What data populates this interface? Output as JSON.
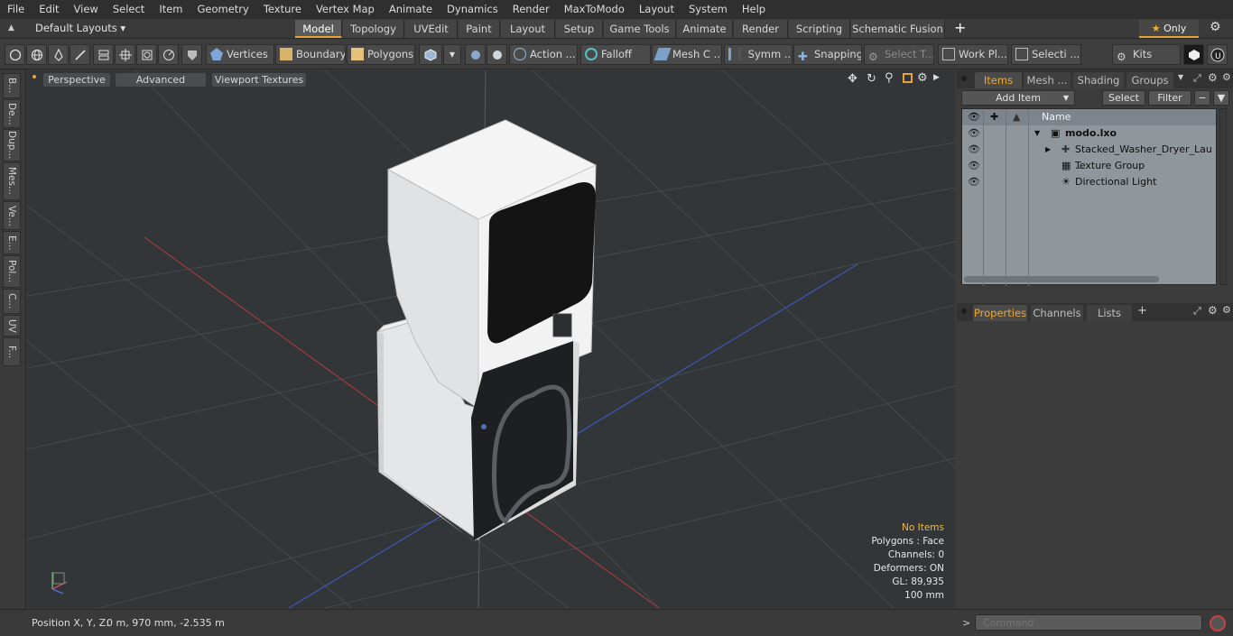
{
  "menu": [
    "File",
    "Edit",
    "View",
    "Select",
    "Item",
    "Geometry",
    "Texture",
    "Vertex Map",
    "Animate",
    "Dynamics",
    "Render",
    "MaxToModo",
    "Layout",
    "System",
    "Help"
  ],
  "layouts": {
    "label": "Default Layouts ▾"
  },
  "tabs": [
    "Model",
    "Topology",
    "UVEdit",
    "Paint",
    "Layout",
    "Setup",
    "Game Tools",
    "Animate",
    "Render",
    "Scripting",
    "Schematic Fusion"
  ],
  "tab_add": "+",
  "only_label": "Only",
  "toolbar": {
    "vertices": "Vertices",
    "boundary": "Boundary",
    "polygons": "Polygons",
    "action": "Action",
    "falloff": "Falloff",
    "mesh": "Mesh C ...",
    "symm": "Symm ...",
    "snapping": "Snapping",
    "select_t": "Select T...",
    "work_pl": "Work Pl...",
    "selecti": "Selecti ...",
    "kits": "Kits"
  },
  "left_tabs": [
    "B...",
    "De...",
    "Dup...",
    "Mes...",
    "Ve...",
    "E...",
    "Pol...",
    "C...",
    "UV",
    "F..."
  ],
  "viewport": {
    "perspective": "Perspective",
    "advanced": "Advanced",
    "viewport_textures": "Viewport Textures",
    "info": {
      "no_items": "No Items",
      "polygons": "Polygons : Face",
      "channels": "Channels: 0",
      "deformers": "Deformers: ON",
      "gl": "GL: 89,935",
      "scale": "100 mm"
    }
  },
  "items_panel": {
    "tabs": [
      "Items",
      "Mesh ...",
      "Shading",
      "Groups"
    ],
    "add_item": "Add Item",
    "select": "Select",
    "filter": "Filter",
    "name_header": "Name",
    "rows": [
      "modo.lxo",
      "Stacked_Washer_Dryer_Lau ...",
      "Texture Group",
      "Directional Light"
    ]
  },
  "properties_panel": {
    "tabs": [
      "Properties",
      "Channels",
      "Lists"
    ],
    "add": "+"
  },
  "status": {
    "position_label": "Position X, Y, Z:",
    "position_value": "0 m, 970 mm, -2.535 m"
  },
  "command": {
    "placeholder": "Command"
  },
  "colors": {
    "accent": "#e8a23a",
    "viewport_bg": "#323638",
    "list_bg": "#8f969c"
  }
}
